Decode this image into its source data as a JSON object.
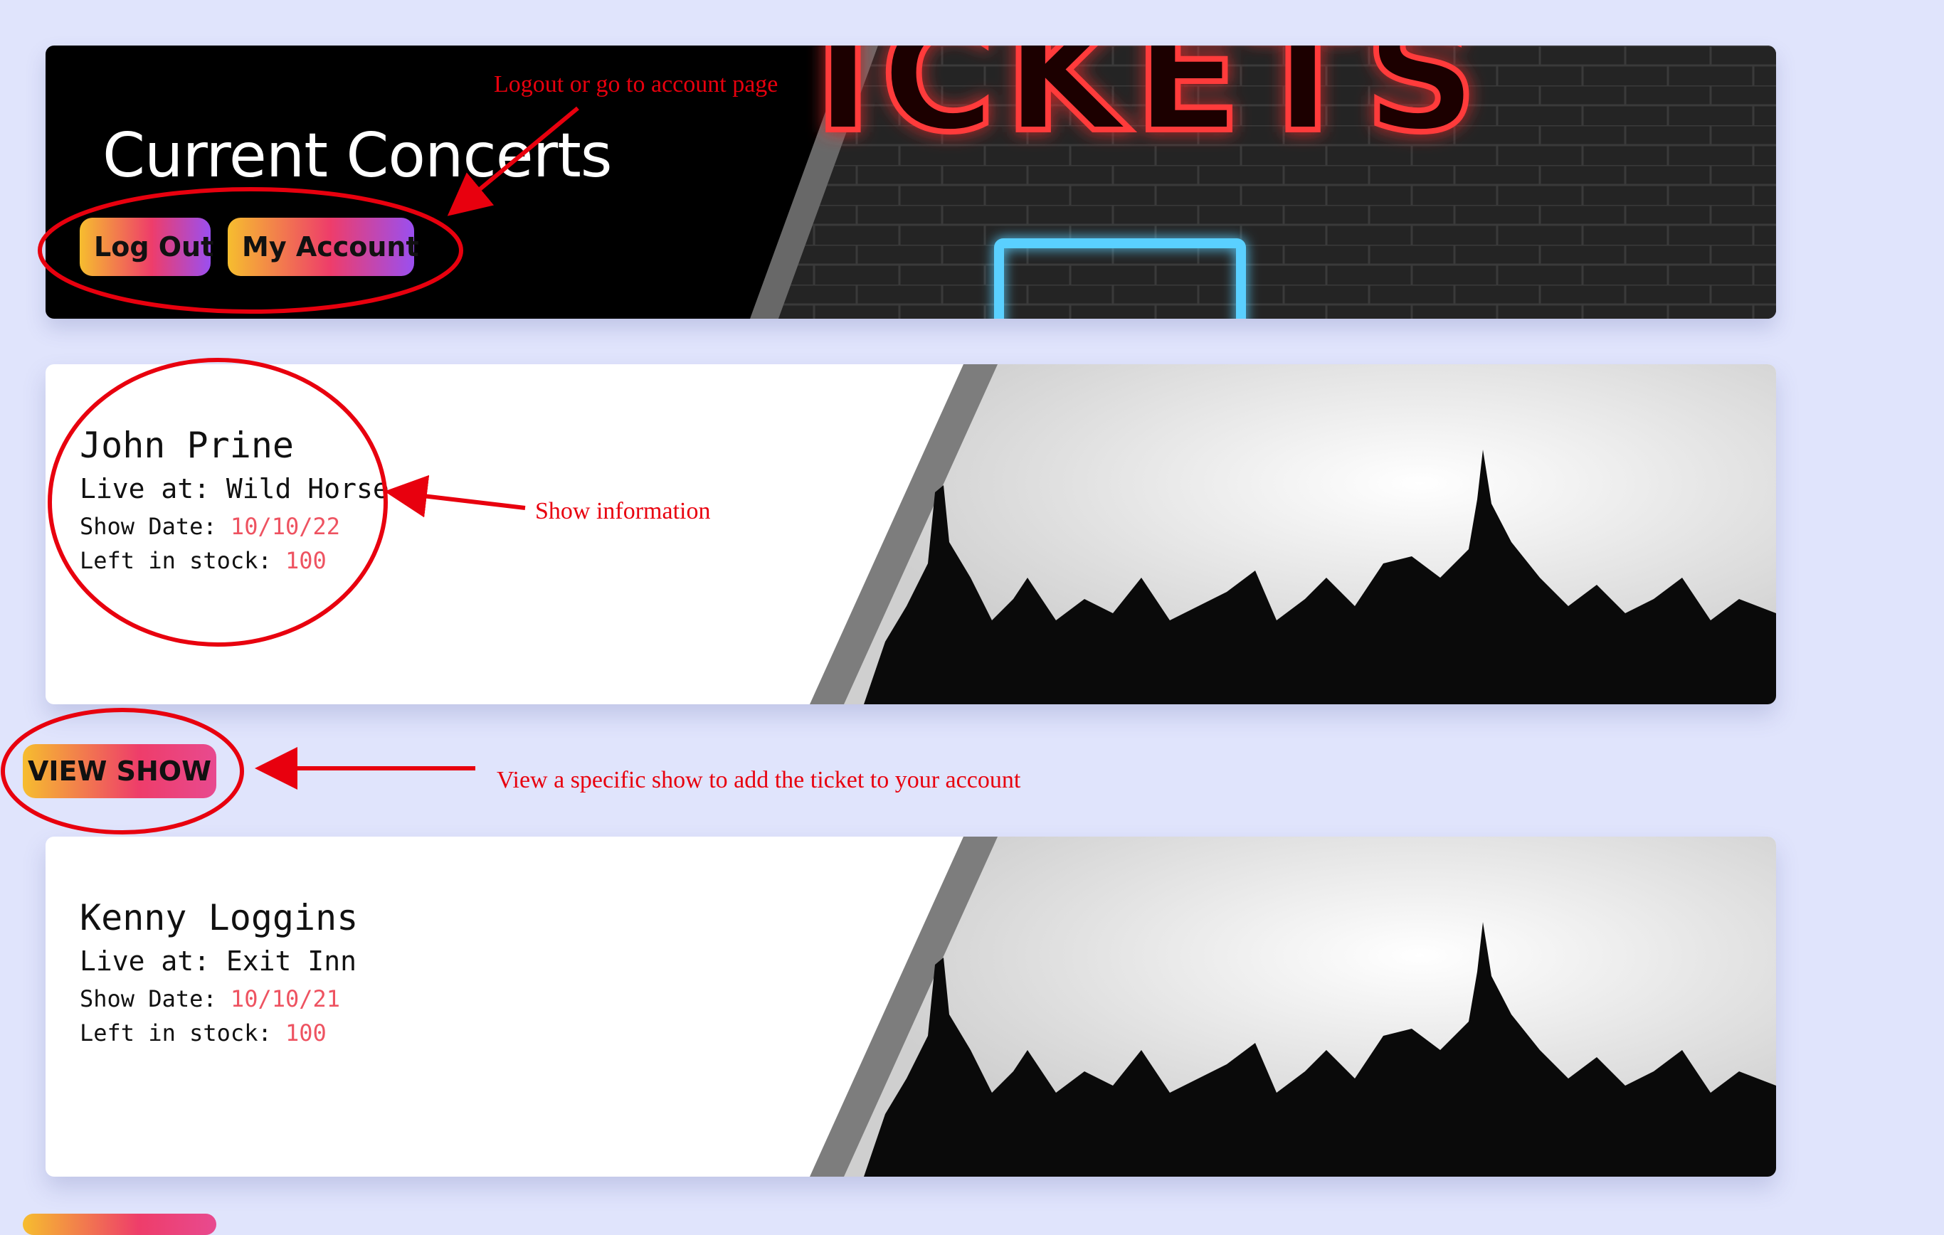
{
  "header": {
    "title": "Current Concerts",
    "logout_label": "Log Out",
    "account_label": "My Account",
    "sign_text": "ICKETS"
  },
  "concerts": [
    {
      "artist": "John Prine",
      "venue_label": "Live at:",
      "venue": "Wild Horse",
      "date_label": "Show Date:",
      "date": "10/10/22",
      "stock_label": "Left in stock:",
      "stock": "100",
      "button_label": "VIEW SHOW"
    },
    {
      "artist": "Kenny Loggins",
      "venue_label": "Live at:",
      "venue": "Exit Inn",
      "date_label": "Show Date:",
      "date": "10/10/21",
      "stock_label": "Left in stock:",
      "stock": "100"
    }
  ],
  "annotations": {
    "header_note": "Logout or go to account page",
    "show_note": "Show information",
    "button_note": "View a specific show to add the ticket to your account"
  },
  "colors": {
    "page_background": "#e0e4fc",
    "accent_text": "#ee5361",
    "annotation_red": "#e8000e",
    "button_gradient_start": "#f6bd2f",
    "button_gradient_mid": "#ee3d6a",
    "button_gradient_end": "#9a4ff0"
  }
}
